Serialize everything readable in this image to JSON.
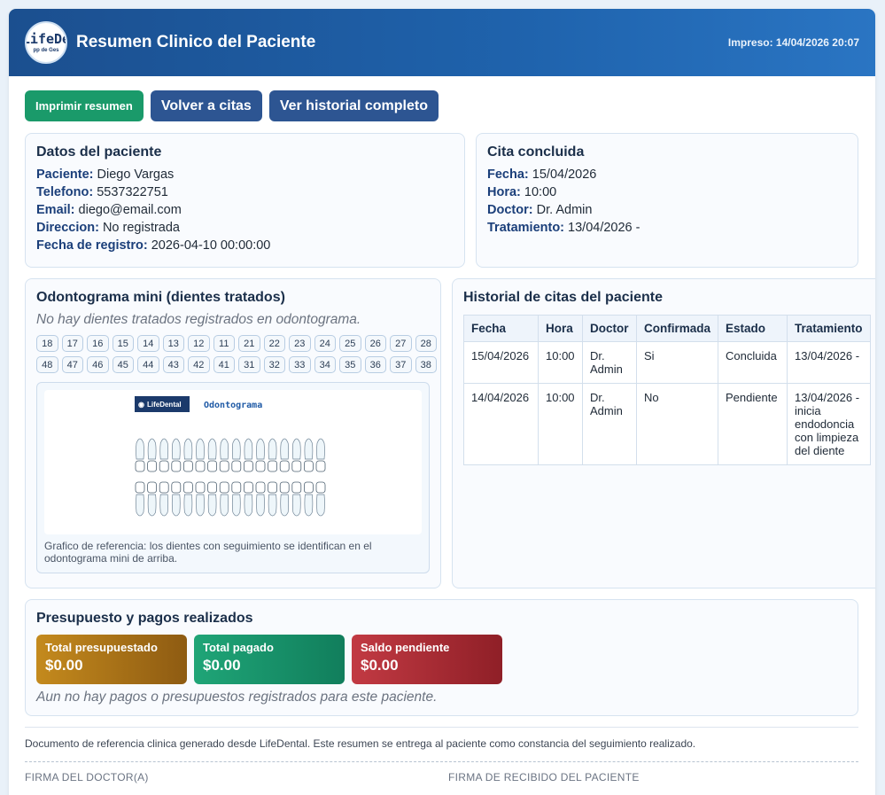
{
  "header": {
    "logo_text": "LifeDe",
    "logo_sub": "pp de Ges",
    "title": "Resumen Clinico del Paciente",
    "printed": "Impreso: 14/04/2026 20:07"
  },
  "toolbar": {
    "print_label": "Imprimir resumen",
    "back_label": "Volver a citas",
    "history_label": "Ver historial completo"
  },
  "patient": {
    "title": "Datos del paciente",
    "fields": [
      {
        "label": "Paciente:",
        "value": "Diego Vargas"
      },
      {
        "label": "Telefono:",
        "value": "5537322751"
      },
      {
        "label": "Email:",
        "value": "diego@email.com"
      },
      {
        "label": "Direccion:",
        "value": "No registrada"
      },
      {
        "label": "Fecha de registro:",
        "value": "2026-04-10 00:00:00"
      }
    ]
  },
  "appointment": {
    "title": "Cita concluida",
    "fields": [
      {
        "label": "Fecha:",
        "value": "15/04/2026"
      },
      {
        "label": "Hora:",
        "value": "10:00"
      },
      {
        "label": "Doctor:",
        "value": "Dr. Admin"
      },
      {
        "label": "Tratamiento:",
        "value": "13/04/2026 -"
      }
    ]
  },
  "odontogram": {
    "title": "Odontograma mini (dientes tratados)",
    "empty_text": "No hay dientes tratados registrados en odontograma.",
    "upper": [
      "18",
      "17",
      "16",
      "15",
      "14",
      "13",
      "12",
      "11",
      "21",
      "22",
      "23",
      "24",
      "25",
      "26",
      "27",
      "28"
    ],
    "lower": [
      "48",
      "47",
      "46",
      "45",
      "44",
      "43",
      "42",
      "41",
      "31",
      "32",
      "33",
      "34",
      "35",
      "36",
      "37",
      "38"
    ],
    "chart_brand": "LifeDental",
    "chart_title": "Odontograma",
    "caption": "Grafico de referencia: los dientes con seguimiento se identifican en el odontograma mini de arriba."
  },
  "history": {
    "title": "Historial de citas del paciente",
    "columns": [
      "Fecha",
      "Hora",
      "Doctor",
      "Confirmada",
      "Estado",
      "Tratamiento"
    ],
    "rows": [
      [
        "15/04/2026",
        "10:00",
        "Dr. Admin",
        "Si",
        "Concluida",
        "13/04/2026 -"
      ],
      [
        "14/04/2026",
        "10:00",
        "Dr. Admin",
        "No",
        "Pendiente",
        "13/04/2026 - inicia endodoncia con limpieza del diente"
      ]
    ]
  },
  "finance": {
    "title": "Presupuesto y pagos realizados",
    "cards": [
      {
        "label": "Total presupuestado",
        "value": "$0.00",
        "color": "#b98119"
      },
      {
        "label": "Total pagado",
        "value": "$0.00",
        "color": "#1a9a6a"
      },
      {
        "label": "Saldo pendiente",
        "value": "$0.00",
        "color": "#b3303a"
      }
    ],
    "empty_text": "Aun no hay pagos o presupuestos registrados para este paciente."
  },
  "footer": {
    "note": "Documento de referencia clinica generado desde LifeDental. Este resumen se entrega al paciente como constancia del seguimiento realizado.",
    "sign_doctor": "FIRMA DEL DOCTOR(A)",
    "sign_patient": "FIRMA DE RECIBIDO DEL PACIENTE"
  }
}
